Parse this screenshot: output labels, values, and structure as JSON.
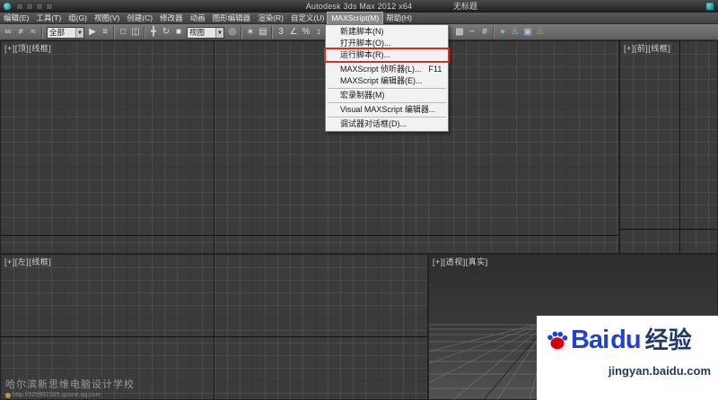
{
  "title_bar": {
    "app_title": "Autodesk 3ds Max  2012 x64",
    "document_title": "无标题"
  },
  "menu_bar": {
    "items": [
      {
        "id": "edit",
        "label": "编辑(E)"
      },
      {
        "id": "tools",
        "label": "工具(T)"
      },
      {
        "id": "group",
        "label": "组(G)"
      },
      {
        "id": "views",
        "label": "视图(V)"
      },
      {
        "id": "create",
        "label": "创建(C)"
      },
      {
        "id": "modifiers",
        "label": "修改器"
      },
      {
        "id": "animation",
        "label": "动画"
      },
      {
        "id": "graph-editors",
        "label": "图形编辑器"
      },
      {
        "id": "rendering",
        "label": "渲染(R)"
      },
      {
        "id": "customize",
        "label": "自定义(U)"
      },
      {
        "id": "maxscript",
        "label": "MAXScript(M)",
        "active": true
      },
      {
        "id": "help",
        "label": "帮助(H)"
      }
    ]
  },
  "toolbar": {
    "left_items": [
      {
        "type": "icon",
        "name": "select-and-link",
        "glyph": "∞"
      },
      {
        "type": "icon",
        "name": "unlink-selection",
        "glyph": "≠"
      },
      {
        "type": "icon",
        "name": "bind-to-space-warp",
        "glyph": "≈"
      },
      {
        "type": "sep"
      },
      {
        "type": "dropdown",
        "name": "selection-filter",
        "value": "全部",
        "arrow": "▼",
        "width": 42
      },
      {
        "type": "icon",
        "name": "select-object",
        "glyph": "▶"
      },
      {
        "type": "icon",
        "name": "select-by-name",
        "glyph": "≡"
      },
      {
        "type": "sep"
      },
      {
        "type": "icon",
        "name": "selection-region",
        "glyph": "□"
      },
      {
        "type": "icon",
        "name": "window-crossing",
        "glyph": "◫"
      },
      {
        "type": "sep"
      },
      {
        "type": "icon",
        "name": "select-and-move",
        "glyph": "╋"
      },
      {
        "type": "icon",
        "name": "select-and-rotate",
        "glyph": "↻"
      },
      {
        "type": "icon",
        "name": "select-and-scale",
        "glyph": "■"
      },
      {
        "type": "dropdown",
        "name": "reference-coordinate-system",
        "value": "视图",
        "arrow": "▼",
        "width": 42
      },
      {
        "type": "icon",
        "name": "use-pivot-center",
        "glyph": "◎"
      },
      {
        "type": "sep"
      },
      {
        "type": "icon",
        "name": "select-and-manipulate",
        "glyph": "∗"
      },
      {
        "type": "icon",
        "name": "keyboard-shortcut-override",
        "glyph": "▤"
      },
      {
        "type": "sep"
      },
      {
        "type": "icon",
        "name": "snap-toggle-3d",
        "glyph": "3"
      },
      {
        "type": "icon",
        "name": "angle-snap",
        "glyph": "∠"
      },
      {
        "type": "icon",
        "name": "percent-snap",
        "glyph": "%"
      },
      {
        "type": "icon",
        "name": "spinner-snap",
        "glyph": "↕"
      },
      {
        "type": "sep"
      },
      {
        "type": "icon",
        "name": "edit-named-selection-sets",
        "glyph": "▦"
      },
      {
        "type": "dropdown",
        "name": "named-selection-sets",
        "value": "",
        "arrow": "▼",
        "width": 54
      },
      {
        "type": "sep"
      },
      {
        "type": "icon",
        "name": "mirror",
        "glyph": "▧"
      },
      {
        "type": "icon",
        "name": "align",
        "glyph": "⊞"
      },
      {
        "type": "icon",
        "name": "layer-manager",
        "glyph": "▥"
      }
    ],
    "right_items": [
      {
        "type": "icon",
        "name": "graphite-modeling-tools",
        "glyph": "▩"
      },
      {
        "type": "icon",
        "name": "curve-editor",
        "glyph": "~"
      },
      {
        "type": "icon",
        "name": "schematic-view",
        "glyph": "#"
      },
      {
        "type": "sep"
      },
      {
        "type": "icon",
        "name": "material-editor",
        "glyph": "●",
        "color": "#63c0c9"
      },
      {
        "type": "icon",
        "name": "render-setup",
        "glyph": "♨",
        "color": "#d8d8d8"
      },
      {
        "type": "icon",
        "name": "rendered-frame-window",
        "glyph": "▣",
        "color": "#a6c8e4"
      },
      {
        "type": "icon",
        "name": "render-production",
        "glyph": "♨",
        "color": "#e8b34b"
      }
    ]
  },
  "maxscript_menu": {
    "items": [
      {
        "name": "new-script",
        "label": "新建脚本(N)",
        "shortcut": ""
      },
      {
        "name": "open-script",
        "label": "打开脚本(O)...",
        "shortcut": ""
      },
      {
        "name": "run-script",
        "label": "运行脚本(R)...",
        "shortcut": "",
        "boxed": true,
        "sep_after": true
      },
      {
        "name": "maxscript-listener",
        "label": "MAXScript 侦听器(L)...",
        "shortcut": "F11"
      },
      {
        "name": "maxscript-editor",
        "label": "MAXScript 编辑器(E)...",
        "shortcut": "",
        "sep_after": true
      },
      {
        "name": "macro-recorder",
        "label": "宏录制器(M)",
        "shortcut": "",
        "sep_after": true
      },
      {
        "name": "visual-maxscript-editor",
        "label": "Visual MAXScript 编辑器...",
        "shortcut": "",
        "sep_after": true
      },
      {
        "name": "debugger-dialog",
        "label": "调试器对话框(D)...",
        "shortcut": ""
      }
    ],
    "annotation_color": "#de2b22"
  },
  "viewports": {
    "top": {
      "label": "[+][顶][线框]"
    },
    "front": {
      "label": "[+][前][线框]"
    },
    "left": {
      "label": "[+][左][线框]"
    },
    "perspective": {
      "label": "[+][透视][真实]"
    }
  },
  "watermarks": {
    "school": {
      "name": "哈尔滨新思维电脑设计学校",
      "url": "http://329991585.qzone.qq.com"
    },
    "baidu": {
      "brand_latin": "Bai",
      "brand_latin2": "du",
      "brand_cn": "经验",
      "site": "jingyan.baidu.com"
    }
  },
  "colors": {
    "annotation_red": "#de2b22",
    "baidu_blue": "#2440d0",
    "baidu_red": "#d7000f"
  }
}
